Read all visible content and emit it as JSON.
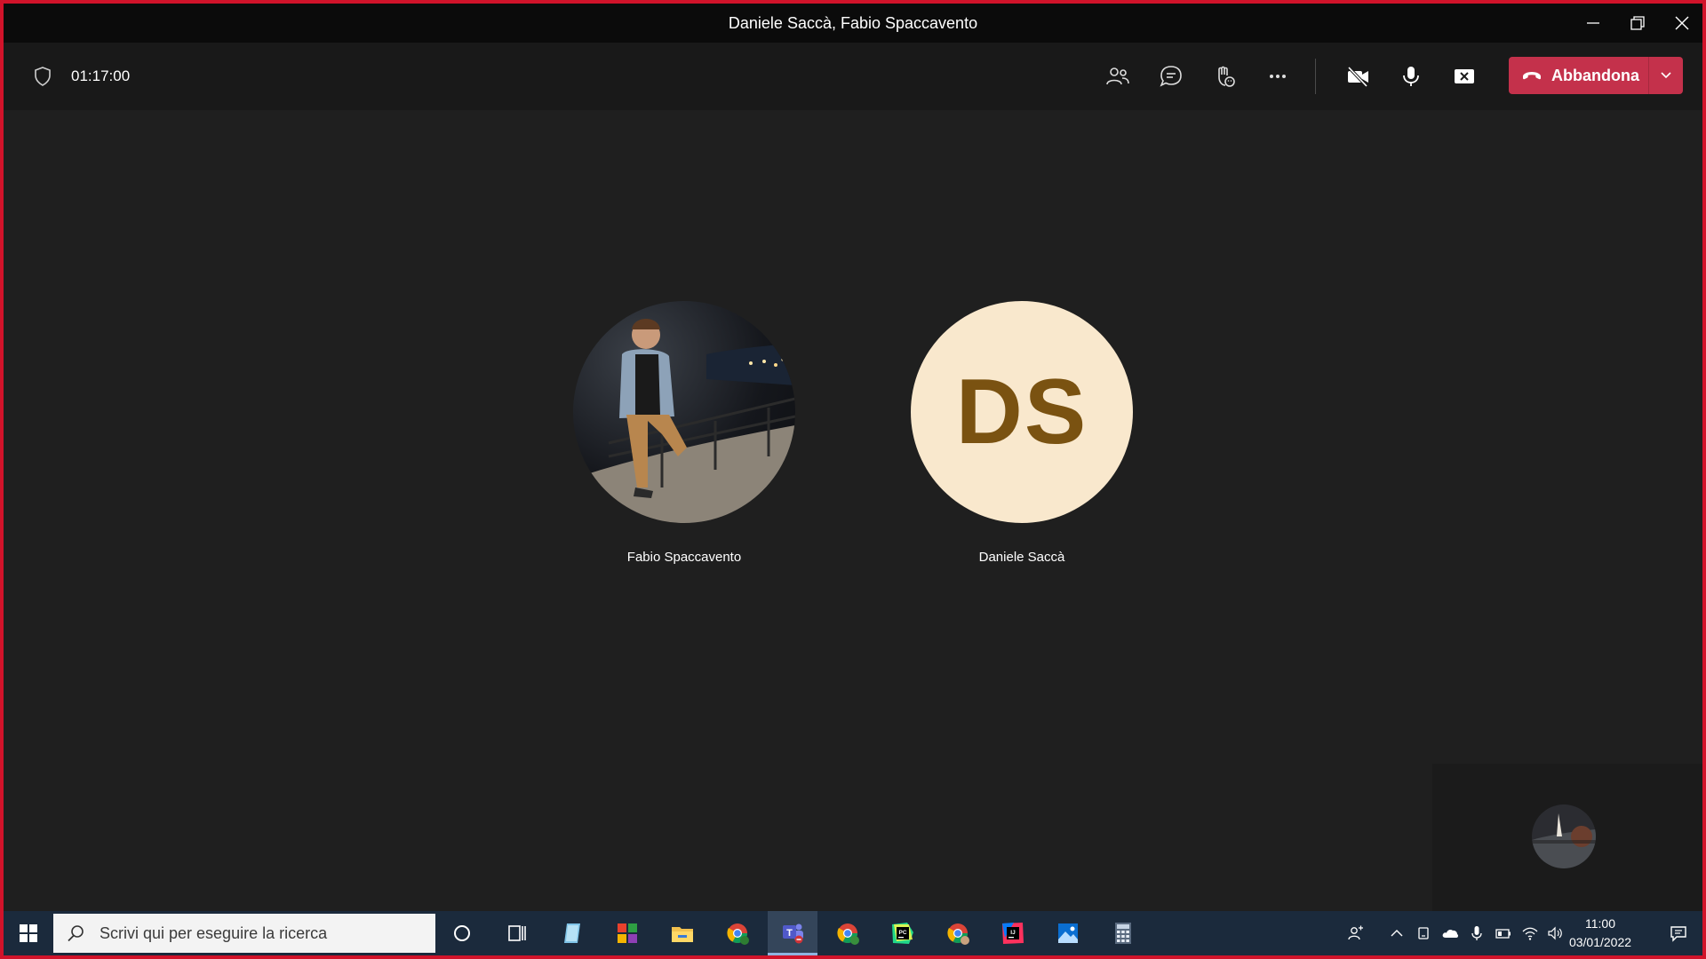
{
  "window": {
    "title": "Daniele Saccà, Fabio Spaccavento"
  },
  "meeting": {
    "timer": "01:17:00",
    "leave_label": "Abbandona"
  },
  "participants": [
    {
      "name": "Fabio Spaccavento",
      "avatar": "photo"
    },
    {
      "name": "Daniele Saccà",
      "initials": "DS"
    }
  ],
  "taskbar": {
    "search_placeholder": "Scrivi qui per eseguire la ricerca",
    "time": "11:00",
    "date": "03/01/2022"
  },
  "colors": {
    "leave_button": "#c4314b",
    "frame_border": "#d1132a",
    "initials_bg": "#f9e8cd",
    "initials_fg": "#7a5211"
  },
  "icons": {
    "toolbar": [
      "shield-icon",
      "people-icon",
      "chat-icon",
      "raise-hand-icon",
      "more-icon",
      "camera-off-icon",
      "microphone-icon",
      "share-stop-icon"
    ],
    "taskbar": [
      "windows-start-icon",
      "search-icon",
      "cortana-icon",
      "task-view-icon",
      "notepad-icon",
      "colorful-app-icon",
      "file-explorer-icon",
      "chrome-l-icon",
      "teams-icon",
      "chrome-r-icon",
      "pycharm-icon",
      "chrome-avatar-icon",
      "intellij-icon",
      "photos-icon",
      "calculator-icon"
    ]
  }
}
